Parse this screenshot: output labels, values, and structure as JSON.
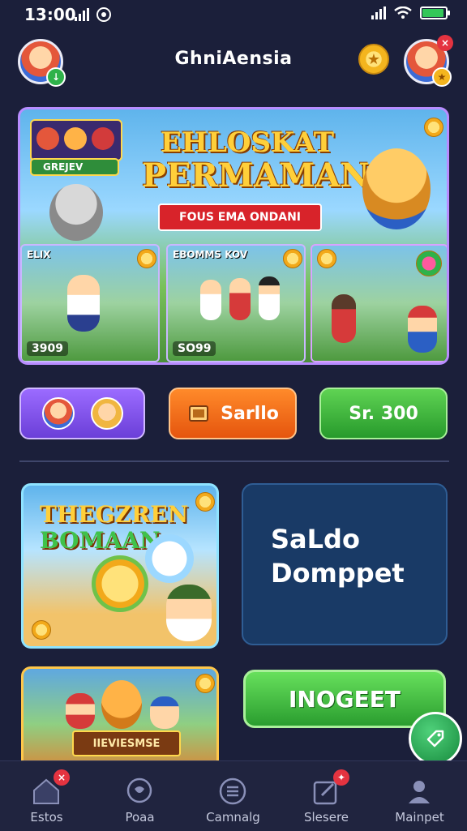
{
  "status_bar": {
    "time": "13:00"
  },
  "header": {
    "title": "GhniAensia",
    "avatar_badge": "×"
  },
  "banner": {
    "title_line1": "EHLOSKAT",
    "title_line2": "PERMAMAN",
    "ribbon": "FOUS EMA ONDANI",
    "mini_label": "GREJEV",
    "tiles": [
      {
        "label": "ELIX",
        "score": "3909"
      },
      {
        "label": "EBOMMS KOV",
        "score": "SO99"
      },
      {
        "label": "",
        "score": ""
      }
    ]
  },
  "buttons": {
    "orange": "Sarllo",
    "green": "Sr. 300"
  },
  "promo": {
    "title_line1": "THEGZREN",
    "title_line2": "BOMAAN"
  },
  "wallet": {
    "line1": "SaLdo",
    "line2": "Domppet"
  },
  "promo2": {
    "label": "IIEVIESMSE"
  },
  "cta": {
    "label": "INOGEET"
  },
  "tabbar": {
    "items": [
      {
        "label": "Estos",
        "badge": "×"
      },
      {
        "label": "Poaa",
        "badge": ""
      },
      {
        "label": "Camnalg",
        "badge": ""
      },
      {
        "label": "Slesere",
        "badge": "✦"
      },
      {
        "label": "Mainpet",
        "badge": ""
      }
    ]
  },
  "colors": {
    "accent_green": "#2a9d2f",
    "accent_orange": "#e5550e",
    "accent_purple": "#6b3fd8",
    "battery": "#34c759"
  }
}
